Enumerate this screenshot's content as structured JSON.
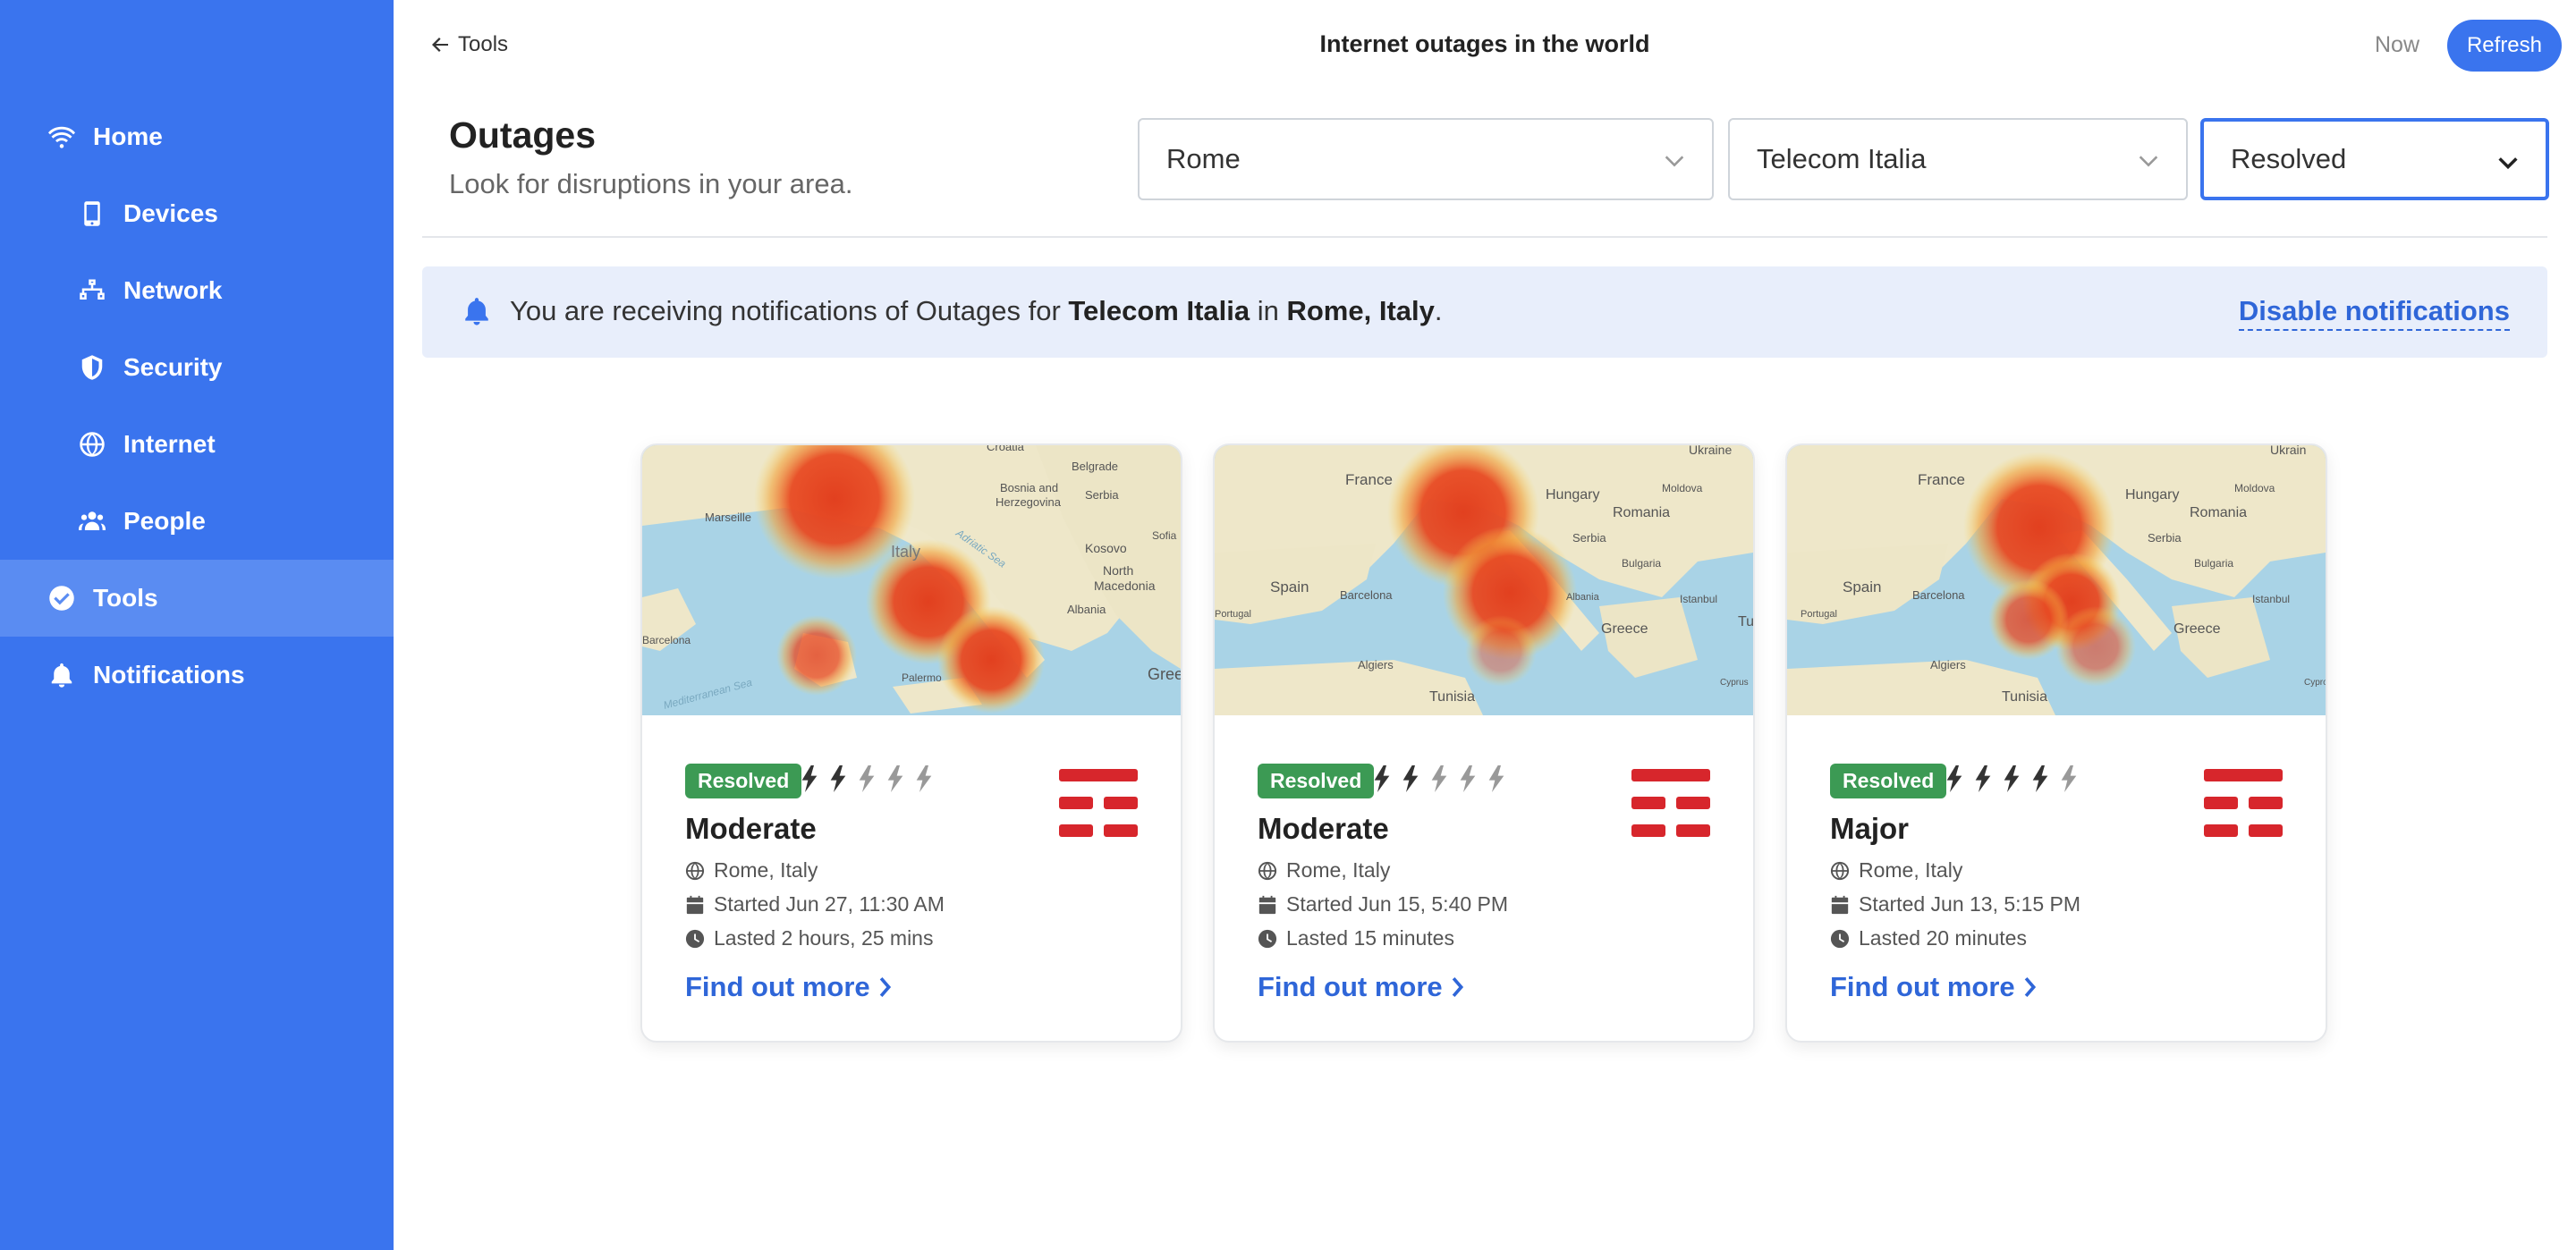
{
  "sidebar": {
    "items": [
      {
        "label": "Home",
        "icon": "wifi-icon",
        "level": "top",
        "active": false
      },
      {
        "label": "Devices",
        "icon": "mobile-icon",
        "level": "sub",
        "active": false
      },
      {
        "label": "Network",
        "icon": "network-icon",
        "level": "sub",
        "active": false
      },
      {
        "label": "Security",
        "icon": "shield-icon",
        "level": "sub",
        "active": false
      },
      {
        "label": "Internet",
        "icon": "globe-icon",
        "level": "sub",
        "active": false
      },
      {
        "label": "People",
        "icon": "users-icon",
        "level": "sub",
        "active": false
      },
      {
        "label": "Tools",
        "icon": "check-circle-icon",
        "level": "top",
        "active": true
      },
      {
        "label": "Notifications",
        "icon": "bell-icon",
        "level": "top",
        "active": false
      }
    ]
  },
  "header": {
    "back_label": "Tools",
    "title": "Internet outages in the world",
    "now_label": "Now",
    "refresh_label": "Refresh"
  },
  "section": {
    "title": "Outages",
    "subtitle": "Look for disruptions in your area."
  },
  "filters": {
    "city": "Rome",
    "provider": "Telecom Italia",
    "status": "Resolved"
  },
  "banner": {
    "prefix": "You are receiving notifications of Outages for ",
    "provider": "Telecom Italia",
    "middle": " in ",
    "location": "Rome, Italy",
    "suffix": ".",
    "disable_label": "Disable notifications"
  },
  "colors": {
    "accent": "#3a74ee",
    "resolved": "#3c9a54",
    "link": "#2f66d8",
    "provider_logo": "#d7262c"
  },
  "cards": [
    {
      "status": "Resolved",
      "bolts_active": 2,
      "bolts_total": 5,
      "severity": "Moderate",
      "location": "Rome, Italy",
      "started": "Started Jun 27, 11:30 AM",
      "duration": "Lasted 2 hours, 25 mins",
      "link": "Find out more",
      "map_labels": [
        "Croatia",
        "Belgrade",
        "Bosnia and",
        "Herzegovina",
        "Serbia",
        "Marseille",
        "Italy",
        "Kosovo",
        "Sofia",
        "North",
        "Macedonia",
        "Albania",
        "Barcelona",
        "Palermo",
        "Gree",
        "Adriatic Sea",
        "Mediterranean Sea"
      ]
    },
    {
      "status": "Resolved",
      "bolts_active": 2,
      "bolts_total": 5,
      "severity": "Moderate",
      "location": "Rome, Italy",
      "started": "Started Jun 15, 5:40 PM",
      "duration": "Lasted 15 minutes",
      "link": "Find out more",
      "map_labels": [
        "Ukraine",
        "France",
        "Hungary",
        "Moldova",
        "Romania",
        "Serbia",
        "Bulgaria",
        "Spain",
        "Barcelona",
        "Portugal",
        "Albania",
        "Istanbul",
        "Greece",
        "Tu",
        "Algiers",
        "Tunisia",
        "Cyprus"
      ]
    },
    {
      "status": "Resolved",
      "bolts_active": 4,
      "bolts_total": 5,
      "severity": "Major",
      "location": "Rome, Italy",
      "started": "Started Jun 13, 5:15 PM",
      "duration": "Lasted 20 minutes",
      "link": "Find out more",
      "map_labels": [
        "Ukrain",
        "France",
        "Hungary",
        "Moldova",
        "Romania",
        "Serbia",
        "Bulgaria",
        "Spain",
        "Barcelona",
        "Portugal",
        "Istanbul",
        "Greece",
        "Algiers",
        "Tunisia",
        "Cypro"
      ]
    }
  ]
}
